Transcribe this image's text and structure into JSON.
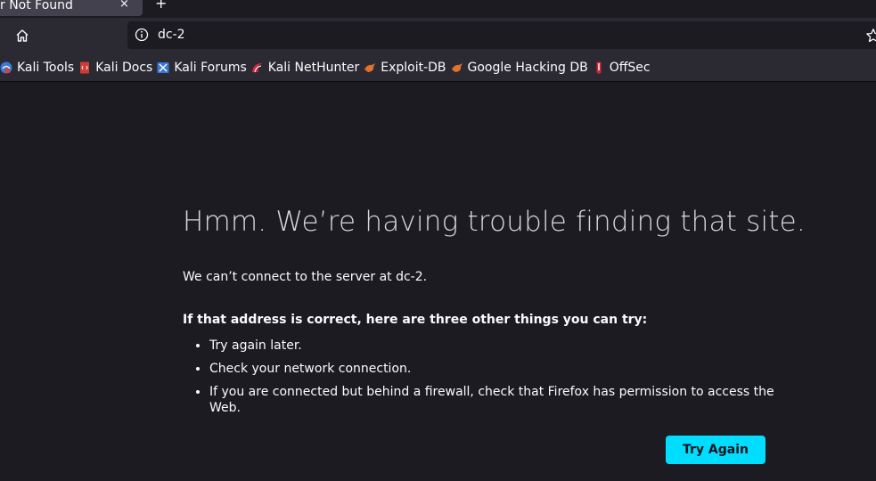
{
  "tab": {
    "title": "r Not Found",
    "close_glyph": "×",
    "new_tab_glyph": "+"
  },
  "navbar": {
    "url": "dc-2",
    "home_icon": "home-icon",
    "info_icon": "info-icon",
    "star_icon": "star-icon"
  },
  "bookmarks": [
    {
      "label": "Kali Tools",
      "icon": "kali-tools-icon"
    },
    {
      "label": "Kali Docs",
      "icon": "kali-docs-icon"
    },
    {
      "label": "Kali Forums",
      "icon": "kali-forums-icon"
    },
    {
      "label": "Kali NetHunter",
      "icon": "kali-nethunter-icon"
    },
    {
      "label": "Exploit-DB",
      "icon": "exploit-db-icon"
    },
    {
      "label": "Google Hacking DB",
      "icon": "google-hacking-db-icon"
    },
    {
      "label": "OffSec",
      "icon": "offsec-icon"
    }
  ],
  "error": {
    "title": "Hmm. We’re having trouble finding that site.",
    "description": "We can’t connect to the server at dc-2.",
    "try_heading": "If that address is correct, here are three other things you can try:",
    "tips": [
      "Try again later.",
      "Check your network connection.",
      "If you are connected but behind a firewall, check that Firefox has permission to access the Web."
    ],
    "button_label": "Try Again"
  },
  "colors": {
    "background": "#1c1b22",
    "toolbar": "#2b2a33",
    "accent_button": "#00ddff"
  }
}
